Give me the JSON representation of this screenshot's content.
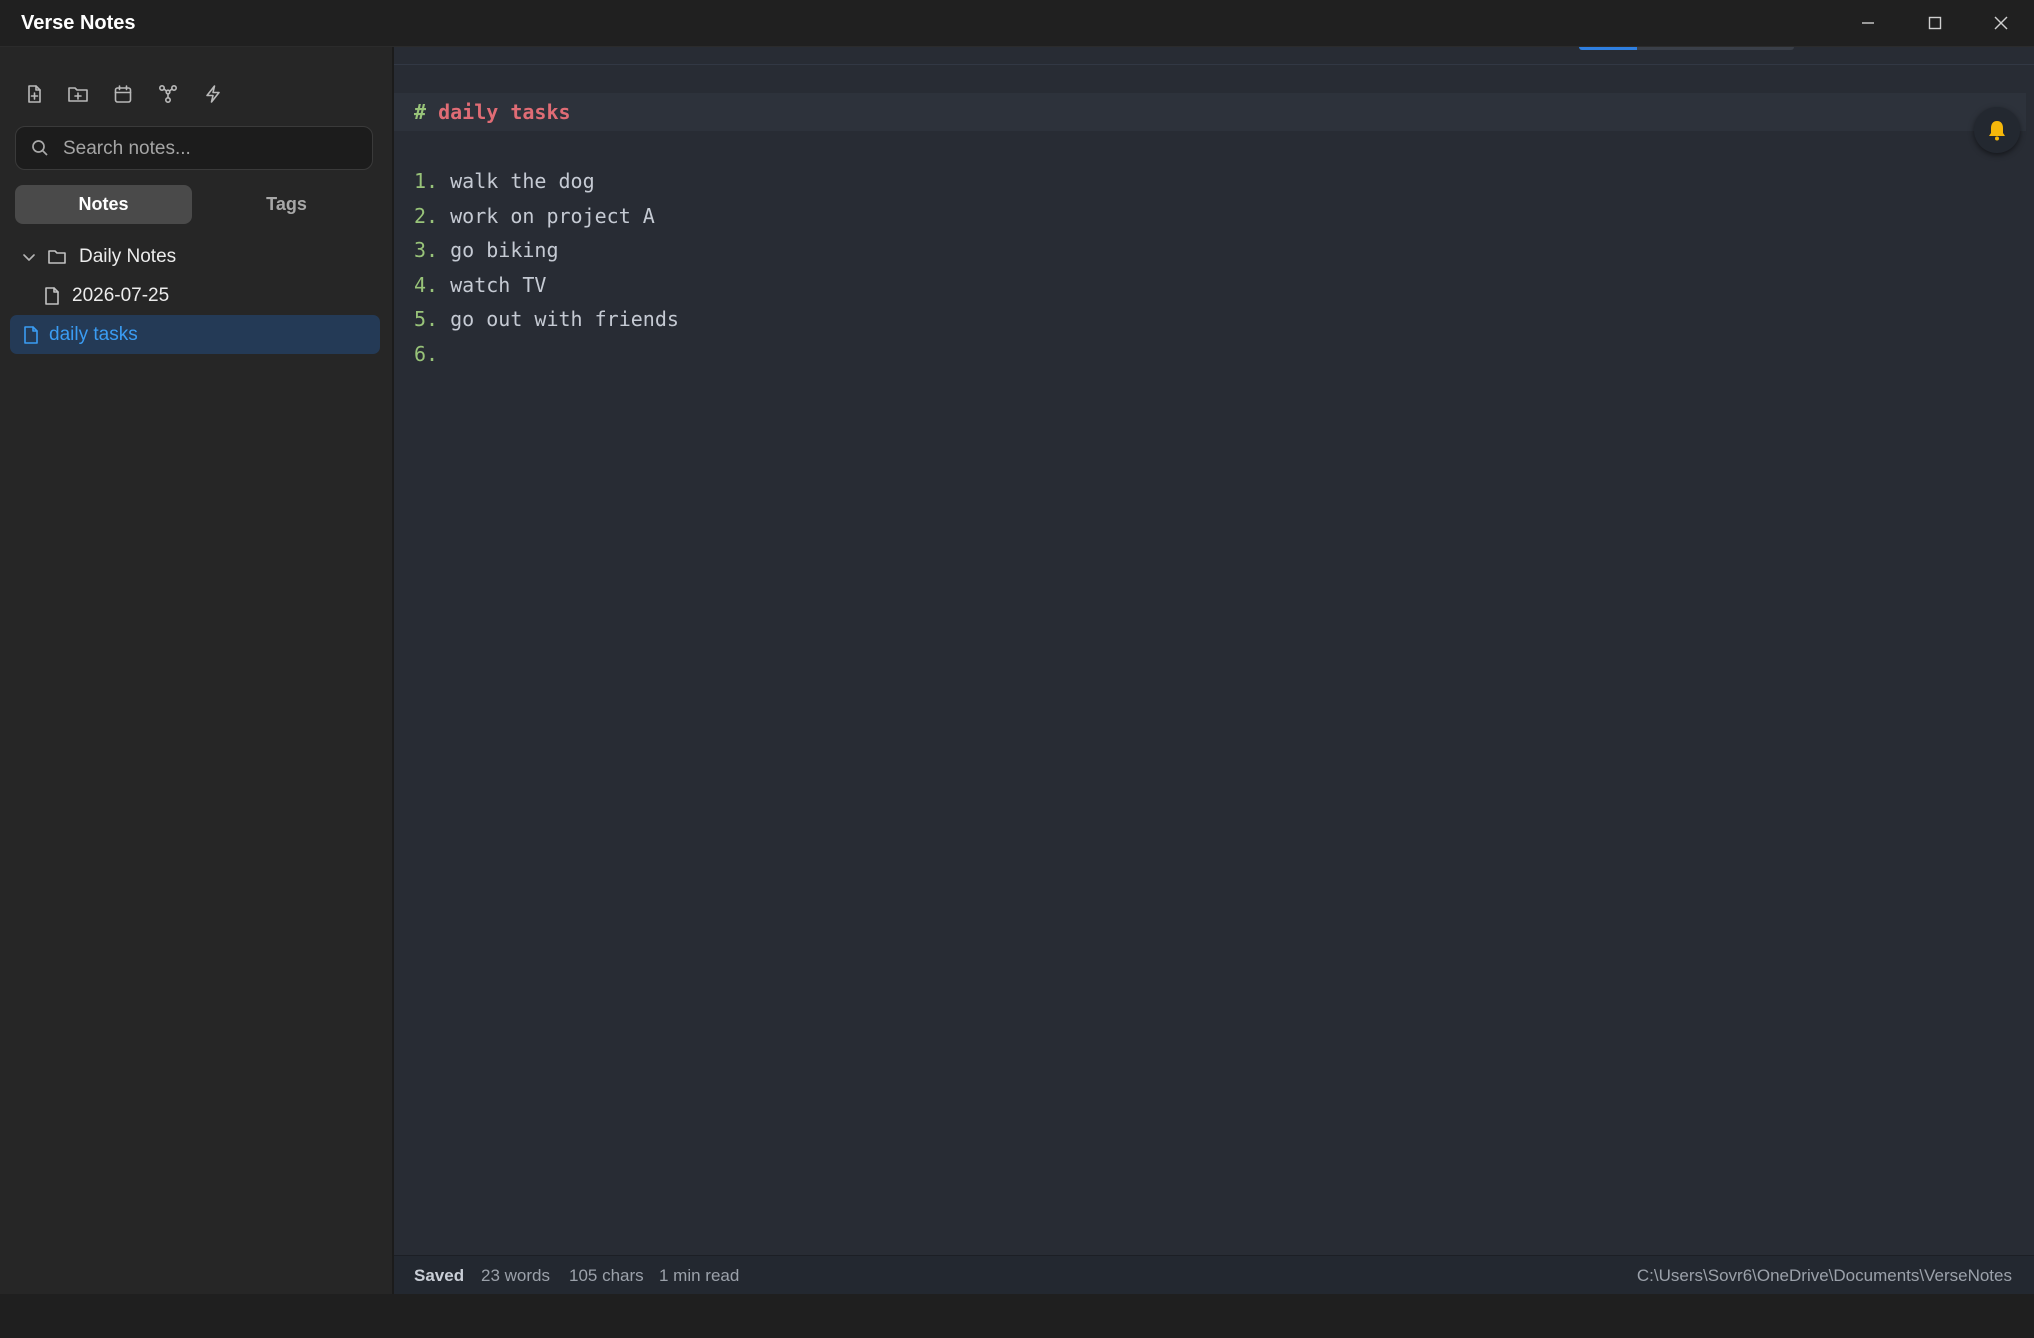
{
  "window": {
    "title": "Verse Notes",
    "controls": [
      "minimize-icon",
      "maximize-icon",
      "close-icon"
    ]
  },
  "sidebar": {
    "toolbar": [
      "new-note-icon",
      "new-folder-icon",
      "calendar-icon",
      "graph-icon",
      "lightning-icon"
    ],
    "search": {
      "placeholder": "Search notes..."
    },
    "tabs": {
      "notes": "Notes",
      "tags": "Tags",
      "active": "Notes"
    },
    "tree": {
      "folder": {
        "label": "Daily Notes",
        "expanded": true
      },
      "folder_child": {
        "label": "2026-07-25"
      },
      "root_note": {
        "label": "daily tasks",
        "selected": true
      }
    }
  },
  "editor": {
    "heading_marker": "#",
    "heading_text": "daily tasks",
    "lines": [
      {
        "num": "1.",
        "text": "walk the dog"
      },
      {
        "num": "2.",
        "text": "work on project A"
      },
      {
        "num": "3.",
        "text": "go biking"
      },
      {
        "num": "4.",
        "text": "watch TV"
      },
      {
        "num": "5.",
        "text": "go out with friends"
      },
      {
        "num": "6.",
        "text": ""
      }
    ],
    "reminder_icon": "bell-icon"
  },
  "statusbar": {
    "saved": "Saved",
    "words": "23 words",
    "chars": "105 chars",
    "read_time": "1 min read",
    "path": "C:\\Users\\Sovr6\\OneDrive\\Documents\\VerseNotes"
  },
  "colors": {
    "accent": "#3a9cf3",
    "heading": "#e06c75",
    "list_number": "#98c379",
    "bell": "#f5b70a"
  }
}
